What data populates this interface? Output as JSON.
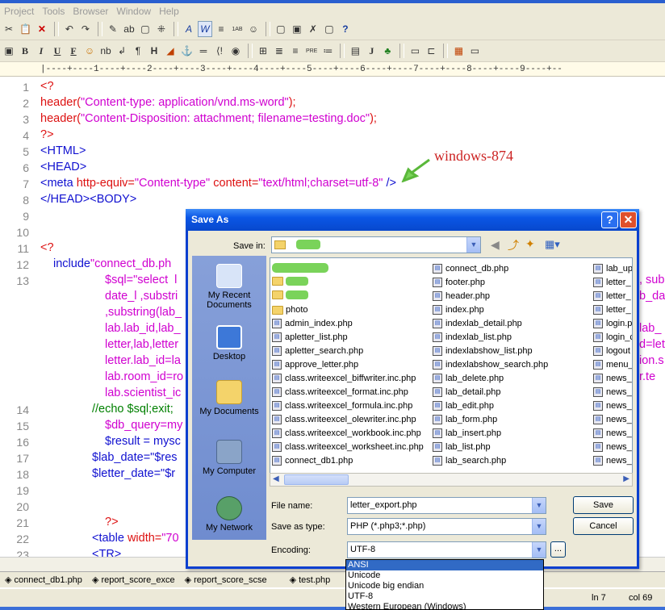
{
  "menu": [
    "Project",
    "Tools",
    "Browser",
    "Window",
    "Help"
  ],
  "toolbar1": [
    "✂",
    "📋",
    "✕",
    "↶",
    "↷",
    "✎",
    "ab",
    "▢",
    "⁜",
    "A",
    "W",
    "≡",
    "1AB",
    "☺",
    "▢",
    "▣",
    "✗",
    "▢",
    "?"
  ],
  "toolbar2": [
    "▣",
    "B",
    "I",
    "U",
    "F",
    "☺",
    "nb",
    "↲",
    "¶",
    "H",
    "◢",
    "⚓",
    "═",
    "⟨!",
    "◉",
    "⊞",
    "≣",
    "≡",
    "PRE",
    "≔",
    "▤",
    "J",
    "♣",
    "▭",
    "⊏",
    "▦",
    "▭"
  ],
  "ruler": "|----+----1----+----2----+----3----+----4----+----5----+----6----+----7----+----8----+----9----+--",
  "lines": {
    "l1": "1",
    "l2": "2",
    "l3": "3",
    "l4": "4",
    "l5": "5",
    "l6": "6",
    "l7": "7",
    "l8": "8",
    "l9": "9",
    "l10": "10",
    "l11": "11",
    "l12": "12",
    "l13": "13",
    "l14": "14",
    "l15": "15",
    "l16": "16",
    "l17": "17",
    "l18": "18",
    "l19": "19",
    "l20": "20",
    "l21": "21",
    "l22": "22",
    "l23": "23"
  },
  "code": {
    "c1": "<?",
    "c2a": "header(",
    "c2b": "\"Content-type: application/vnd.ms-word\"",
    "c2c": ");",
    "c3a": "header(",
    "c3b": "\"Content-Disposition: attachment; filename=testing.doc\"",
    "c3c": ");",
    "c4": "?>",
    "c5": "<HTML>",
    "c6": "<HEAD>",
    "c7a": "<meta ",
    "c7b": "http-equiv=",
    "c7c": "\"Content-type\" ",
    "c7d": "content=",
    "c7e": "\"text/html;charset=utf-8\"",
    "c7f": " />",
    "c8": "</HEAD><BODY>",
    "c11": "<?",
    "c12a": "include",
    "c12b": "\"connect_db.ph",
    "c13a": "$sql=\"select  l",
    "c13b": "date_l ,substri",
    "c13c": ",substring(lab_",
    "c13d": "lab.lab_id,lab_",
    "c13e": "letter,lab,letter",
    "c13f": "letter.lab_id=la",
    "c13g": "lab.room_id=ro",
    "c13h": "lab.scientist_ic",
    "c14": "//echo $sql;exit;",
    "c15": "$db_query=my",
    "c16": "$result = mysc",
    "c17": "$lab_date=\"$res",
    "c18": "$letter_date=\"$r",
    "c21": "?>",
    "c22a": "<table ",
    "c22b": "width=",
    "c22c": "\"70",
    "c23": "<TR>",
    "r13a": ", sub",
    "r13b": "b_da",
    "r13c": "lab_",
    "r13d": "d=let",
    "r13e": "ion.s",
    "r13f": "r.te"
  },
  "annotation": "windows-874",
  "dialog": {
    "title": "Save As",
    "help": "?",
    "close": "✕",
    "save_in_label": "Save in:",
    "places": [
      "My Recent Documents",
      "Desktop",
      "My Documents",
      "My Computer",
      "My Network"
    ],
    "files_col1": [
      "photo",
      "admin_index.php",
      "apletter_list.php",
      "apletter_search.php",
      "approve_letter.php",
      "class.writeexcel_biffwriter.inc.php",
      "class.writeexcel_format.inc.php",
      "class.writeexcel_formula.inc.php",
      "class.writeexcel_olewriter.inc.php",
      "class.writeexcel_workbook.inc.php",
      "class.writeexcel_worksheet.inc.php",
      "connect_db1.php"
    ],
    "files_col2": [
      "connect_db.php",
      "footer.php",
      "header.php",
      "index.php",
      "indexlab_detail.php",
      "indexlab_list.php",
      "indexlabshow_list.php",
      "indexlabshow_search.php",
      "lab_delete.php",
      "lab_detail.php",
      "lab_edit.php",
      "lab_form.php",
      "lab_insert.php",
      "lab_list.php",
      "lab_search.php"
    ],
    "files_col3": [
      "lab_up",
      "letter_",
      "letter_",
      "letter_",
      "login.p",
      "login_c",
      "logout",
      "menu_",
      "news_",
      "news_",
      "news_",
      "news_",
      "news_",
      "news_",
      "news_"
    ],
    "file_name_label": "File name:",
    "file_name_value": "letter_export.php",
    "save_as_type_label": "Save as type:",
    "save_as_type_value": "PHP (*.php3;*.php)",
    "encoding_label": "Encoding:",
    "encoding_value": "UTF-8",
    "save_button": "Save",
    "cancel_button": "Cancel",
    "ellipsis": "...",
    "encoding_options": [
      "ANSI",
      "Unicode",
      "Unicode big endian",
      "UTF-8",
      "Western European (Windows)"
    ]
  },
  "tabs": [
    "◈ connect_db1.php",
    "◈ report_score_exce",
    "◈ report_score_scse",
    "◈ test.php"
  ],
  "status": {
    "ln": "ln 7",
    "col": "col 69"
  },
  "colors": {
    "accent": "#0a56e6",
    "annotation": "#cc2222",
    "code_red": "#d11111",
    "code_magenta": "#d000d0",
    "code_blue": "#1010d0"
  }
}
